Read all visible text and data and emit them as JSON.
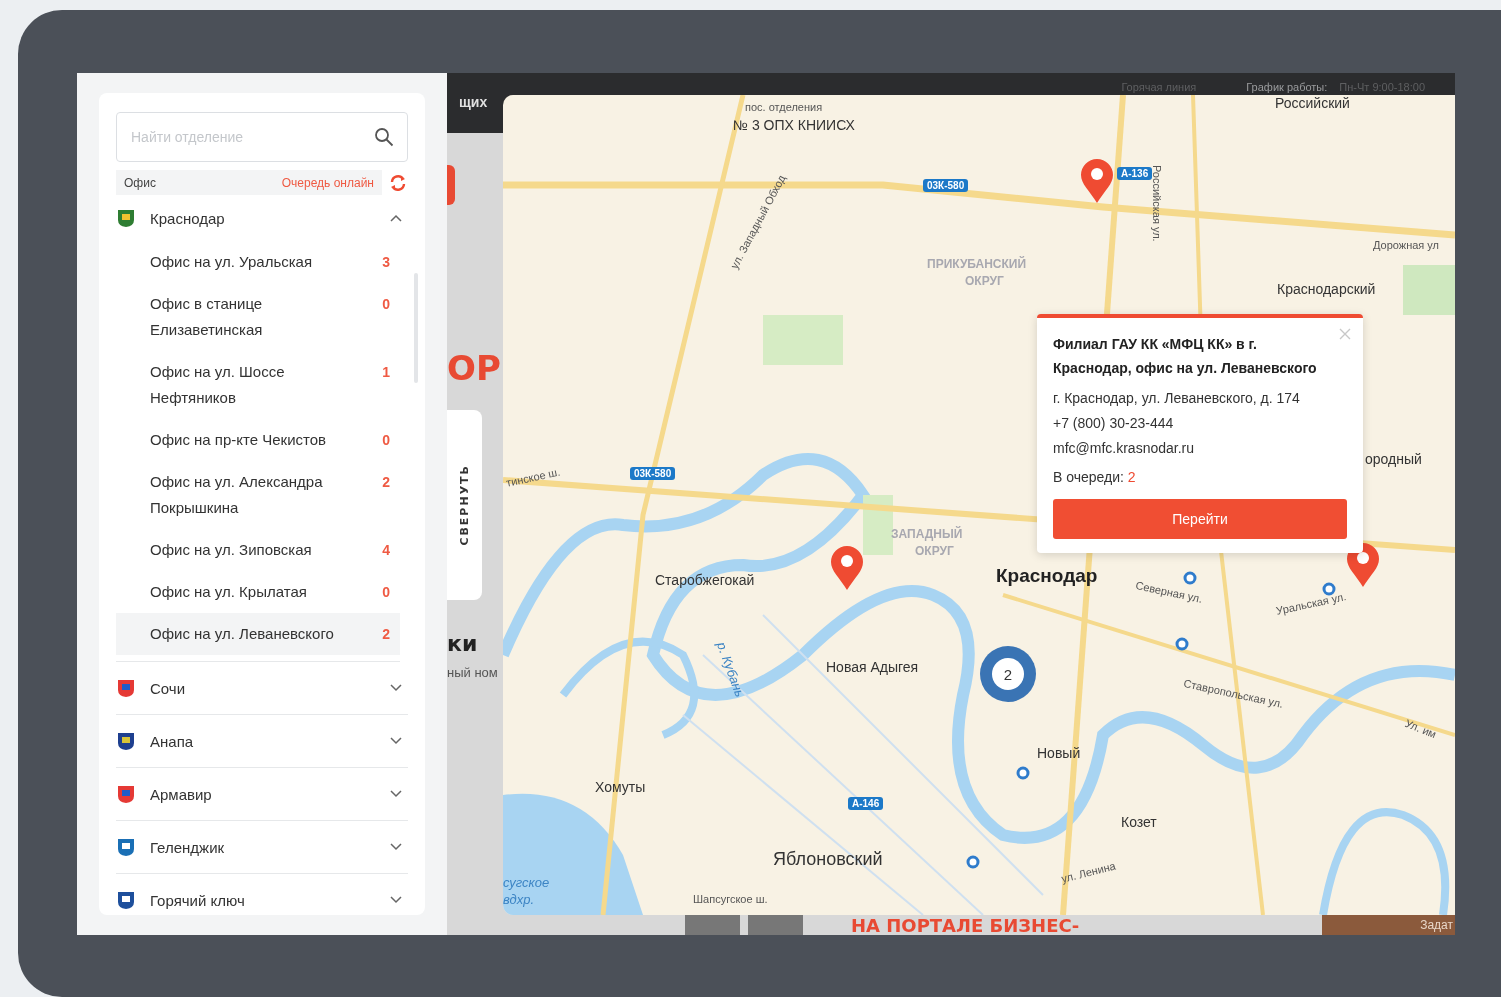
{
  "sidebar": {
    "search": {
      "placeholder": "Найти отделение"
    },
    "header": {
      "office_label": "Офис",
      "queue_label": "Очередь онлайн"
    },
    "cities": [
      {
        "name": "Краснодар",
        "expanded": true,
        "offices": [
          {
            "name": "Офис на ул. Уральская",
            "queue": "3",
            "selected": false
          },
          {
            "name": "Офис в станице Елизаветинская",
            "queue": "0",
            "selected": false
          },
          {
            "name": "Офис на ул. Шоссе Нефтяников",
            "queue": "1",
            "selected": false
          },
          {
            "name": "Офис на пр-кте Чекистов",
            "queue": "0",
            "selected": false
          },
          {
            "name": "Офис на ул. Александра Покрышкина",
            "queue": "2",
            "selected": false
          },
          {
            "name": "Офис на ул. Зиповская",
            "queue": "4",
            "selected": false
          },
          {
            "name": "Офис на ул. Крылатая",
            "queue": "0",
            "selected": false
          },
          {
            "name": "Офис на ул. Леваневского",
            "queue": "2",
            "selected": true
          }
        ]
      },
      {
        "name": "Сочи",
        "expanded": false
      },
      {
        "name": "Анапа",
        "expanded": false
      },
      {
        "name": "Армавир",
        "expanded": false
      },
      {
        "name": "Геленджик",
        "expanded": false
      },
      {
        "name": "Горячий ключ",
        "expanded": false
      }
    ]
  },
  "collapse_tab": {
    "label": "СВЕРНУТЬ"
  },
  "background_page": {
    "top_bar_fragment": "щих",
    "hotline": "Горячая линия",
    "schedule_label": "График работы:",
    "schedule": "Пн-Чт 9:00-18:00",
    "heading_fragment": "ОР",
    "section_fragment": "ки",
    "subtitle_fragment": "ный ном",
    "banner_fragment": "НА ПОРТАЛЕ БИЗНЕС-",
    "ask_fragment": "Задат"
  },
  "map": {
    "labels": [
      {
        "text": "пос. отделения",
        "kind": "small"
      },
      {
        "text": "№ 3 ОПХ КНИИСХ",
        "kind": "place"
      },
      {
        "text": "Российский",
        "kind": "place"
      },
      {
        "text": "03К-580",
        "kind": "road"
      },
      {
        "text": "А-136",
        "kind": "road"
      },
      {
        "text": "ул. Западный Обход",
        "kind": "small"
      },
      {
        "text": "Российская ул.",
        "kind": "small"
      },
      {
        "text": "ПРИКУБАНСКИЙ",
        "kind": "district"
      },
      {
        "text": "ОКРУГ",
        "kind": "district"
      },
      {
        "text": "Дорожная ул",
        "kind": "small"
      },
      {
        "text": "Краснодарский",
        "kind": "place"
      },
      {
        "text": "ородный",
        "kind": "place"
      },
      {
        "text": "тинское ш.",
        "kind": "small"
      },
      {
        "text": "03К-580",
        "kind": "road"
      },
      {
        "text": "ЗАПАДНЫЙ",
        "kind": "district"
      },
      {
        "text": "ОКРУГ",
        "kind": "district"
      },
      {
        "text": "Старобжегокай",
        "kind": "place"
      },
      {
        "text": "Краснодар",
        "kind": "city"
      },
      {
        "text": "Северная ул.",
        "kind": "small"
      },
      {
        "text": "Уральская ул.",
        "kind": "small"
      },
      {
        "text": "р. Кубань",
        "kind": "water"
      },
      {
        "text": "Новая Адыгея",
        "kind": "place"
      },
      {
        "text": "Ставропольская ул.",
        "kind": "small"
      },
      {
        "text": "Ул. им",
        "kind": "small"
      },
      {
        "text": "Новый",
        "kind": "place"
      },
      {
        "text": "Хомуты",
        "kind": "place"
      },
      {
        "text": "А-146",
        "kind": "road"
      },
      {
        "text": "Козет",
        "kind": "place"
      },
      {
        "text": "Яблоновский",
        "kind": "big"
      },
      {
        "text": "ул. Ленина",
        "kind": "small"
      },
      {
        "text": "сугское",
        "kind": "water"
      },
      {
        "text": "вдхр.",
        "kind": "water"
      },
      {
        "text": "Шапсугское ш.",
        "kind": "small"
      }
    ],
    "cluster": {
      "count": "2"
    },
    "popup": {
      "title": "Филиал ГАУ КК «МФЦ КК» в г. Краснодар, офис на ул. Леваневского",
      "address": "г. Краснодар, ул. Леваневского, д. 174",
      "phone": "+7 (800) 30-23-444",
      "email": "mfc@mfc.krasnodar.ru",
      "queue_label": "В очереди:",
      "queue": "2",
      "button": "Перейти"
    }
  }
}
